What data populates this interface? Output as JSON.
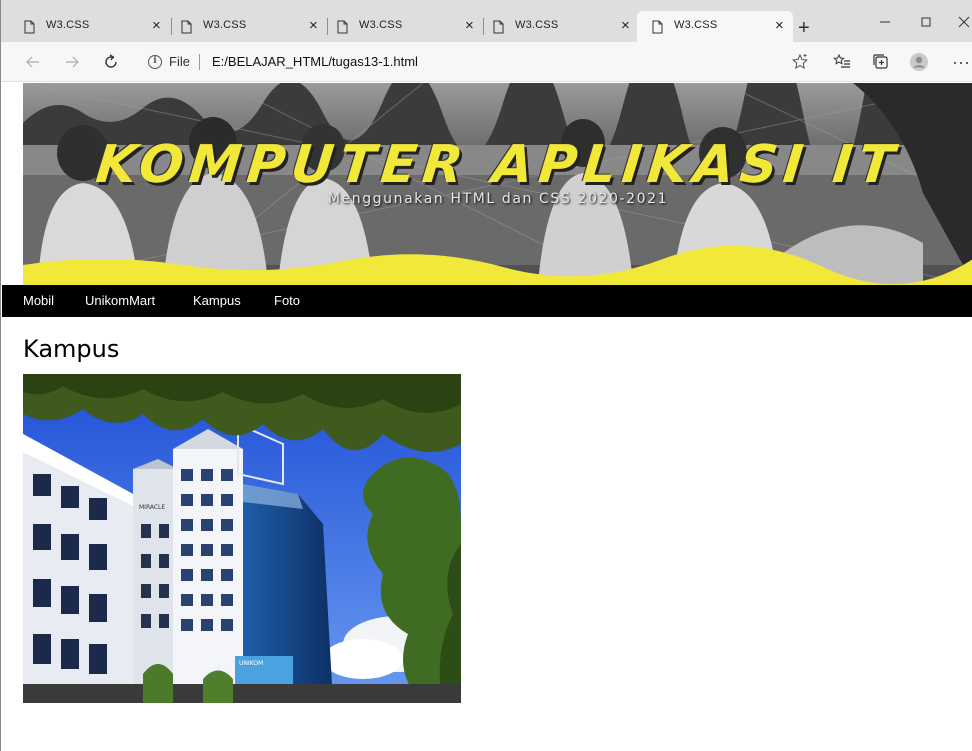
{
  "browser": {
    "tabs": [
      {
        "title": "W3.CSS",
        "close": "×"
      },
      {
        "title": "W3.CSS",
        "close": "×"
      },
      {
        "title": "W3.CSS",
        "close": "×"
      },
      {
        "title": "W3.CSS",
        "close": "×"
      },
      {
        "title": "W3.CSS",
        "close": "×",
        "active": true
      }
    ],
    "new_tab": "+",
    "address": {
      "scheme_label": "File",
      "url": "E:/BELAJAR_HTML/tugas13-1.html"
    }
  },
  "banner": {
    "title": "KOMPUTER APLIKASI IT",
    "subtitle": "Menggunakan HTML dan CSS 2020-2021",
    "accent_color": "#f2e83a"
  },
  "nav": {
    "items": [
      "Mobil",
      "UnikomMart",
      "Kampus",
      "Foto"
    ]
  },
  "main": {
    "heading": "Kampus"
  },
  "photo": {
    "sign_label": "MIRACLE",
    "billboard_label": "UNIKOM"
  }
}
